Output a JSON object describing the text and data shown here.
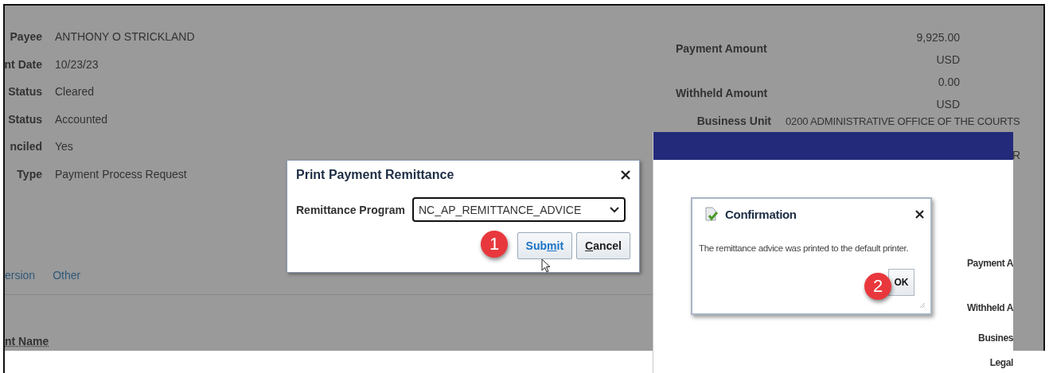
{
  "record_fields": [
    {
      "label": "Payee",
      "value": "ANTHONY O STRICKLAND"
    },
    {
      "label": "nt Date",
      "value": "10/23/23"
    },
    {
      "label": "Status",
      "value": "Cleared"
    },
    {
      "label": "Status",
      "value": "Accounted"
    },
    {
      "label": "nciled",
      "value": "Yes"
    },
    {
      "label": "Type",
      "value": "Payment Process Request"
    }
  ],
  "amounts": [
    {
      "label": "Payment Amount",
      "value": "9,925.00",
      "currency": "USD"
    },
    {
      "label": "Withheld Amount",
      "value": "0.00",
      "currency": "USD"
    }
  ],
  "business_unit": {
    "label": "Business Unit",
    "value": "0200 ADMINISTRATIVE OFFICE OF THE COURTS"
  },
  "fragment": "R",
  "tabs": [
    {
      "label": "ersion",
      "selected": false
    },
    {
      "label": "Other",
      "selected": false
    }
  ],
  "table": {
    "columns": [
      "nt Name"
    ]
  },
  "print_dialog": {
    "title": "Print Payment Remittance",
    "step": "1",
    "field": {
      "label": "Remittance Program",
      "value": "NC_AP_REMITTANCE_ADVICE"
    },
    "buttons": [
      {
        "before": "Sub",
        "key": "m",
        "after": "it",
        "hovered": true
      },
      {
        "key": "C",
        "after": "ancel",
        "hovered": false
      }
    ]
  },
  "second_screenshot": {
    "labels": [
      "Payment A",
      "Withheld A",
      "Busines",
      "Legal"
    ],
    "confirmation": {
      "title": "Confirmation",
      "message": "The remittance advice was printed to the default printer.",
      "button": "OK",
      "step": "2"
    }
  }
}
